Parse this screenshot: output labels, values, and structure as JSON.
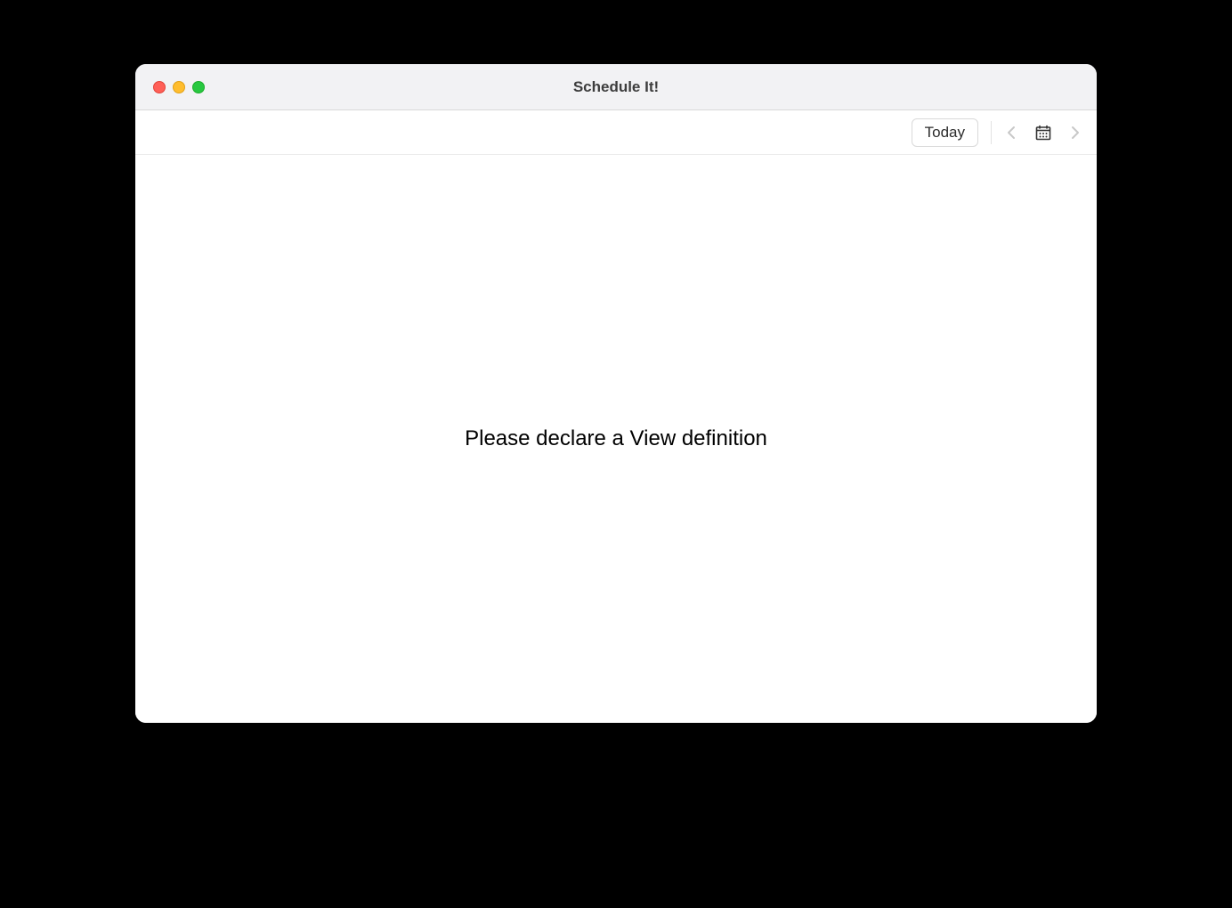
{
  "window": {
    "title": "Schedule It!"
  },
  "toolbar": {
    "today_label": "Today",
    "icons": {
      "prev": "chevron-left-icon",
      "calendar": "calendar-icon",
      "next": "chevron-right-icon"
    }
  },
  "content": {
    "message": "Please declare a View definition"
  },
  "colors": {
    "titlebar_bg": "#f2f2f4",
    "window_bg": "#ffffff",
    "close": "#ff5f57",
    "minimize": "#ffbd2e",
    "maximize": "#28c840"
  }
}
